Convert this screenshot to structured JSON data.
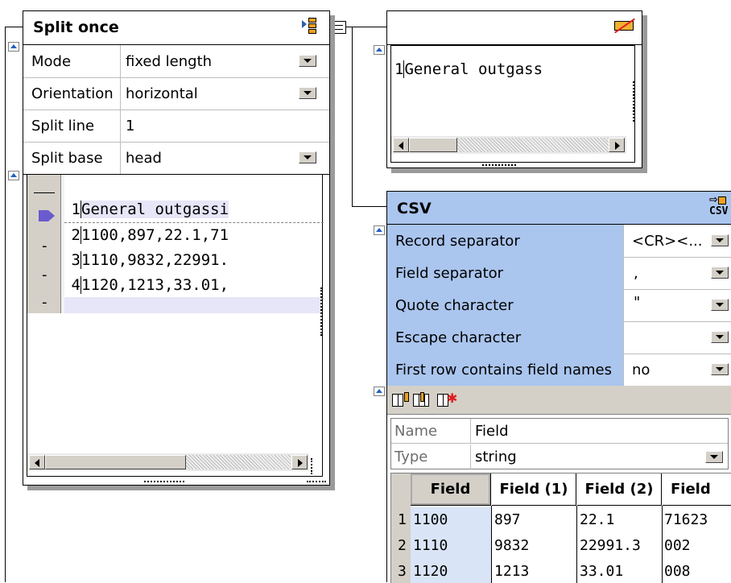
{
  "split_panel": {
    "title": "Split once",
    "props": [
      {
        "label": "Mode",
        "value": "fixed length",
        "dropdown": true
      },
      {
        "label": "Orientation",
        "value": "horizontal",
        "dropdown": true
      },
      {
        "label": "Split line",
        "value": "1",
        "dropdown": false
      },
      {
        "label": "Split base",
        "value": "head",
        "dropdown": true
      }
    ],
    "lines": [
      {
        "num": "1",
        "text": "General outgassi"
      },
      {
        "num": "2",
        "text": "1100,897,22.1,71"
      },
      {
        "num": "3",
        "text": "1110,9832,22991."
      },
      {
        "num": "4",
        "text": "1120,1213,33.01,"
      }
    ],
    "gutter_marks": [
      "-",
      "-",
      "-"
    ]
  },
  "top_right_panel": {
    "lines": [
      {
        "num": "1",
        "text": "General outgass"
      }
    ]
  },
  "csv_panel": {
    "title": "CSV",
    "title_icon": "CSV",
    "props": [
      {
        "label": "Record separator",
        "value": "<CR><..."
      },
      {
        "label": "Field separator",
        "value": ","
      },
      {
        "label": "Quote character",
        "value": "\""
      },
      {
        "label": "Escape character",
        "value": ""
      },
      {
        "label": "First row contains field names",
        "value": "no"
      }
    ],
    "field_props": {
      "name_label": "Name",
      "name_value": "Field",
      "type_label": "Type",
      "type_value": "string"
    },
    "table": {
      "headers": [
        "Field",
        "Field (1)",
        "Field (2)",
        "Field"
      ],
      "rows": [
        {
          "num": "1",
          "cells": [
            "1100",
            "897",
            "22.1",
            "71623"
          ]
        },
        {
          "num": "2",
          "cells": [
            "1110",
            "9832",
            "22991.3",
            "002"
          ]
        },
        {
          "num": "3",
          "cells": [
            "1120",
            "1213",
            "33.01",
            "008"
          ]
        }
      ]
    }
  },
  "colors": {
    "accent_blue": "#aac5ee",
    "selected_line": "#e6e6f8",
    "pointer": "#6a5acd"
  }
}
